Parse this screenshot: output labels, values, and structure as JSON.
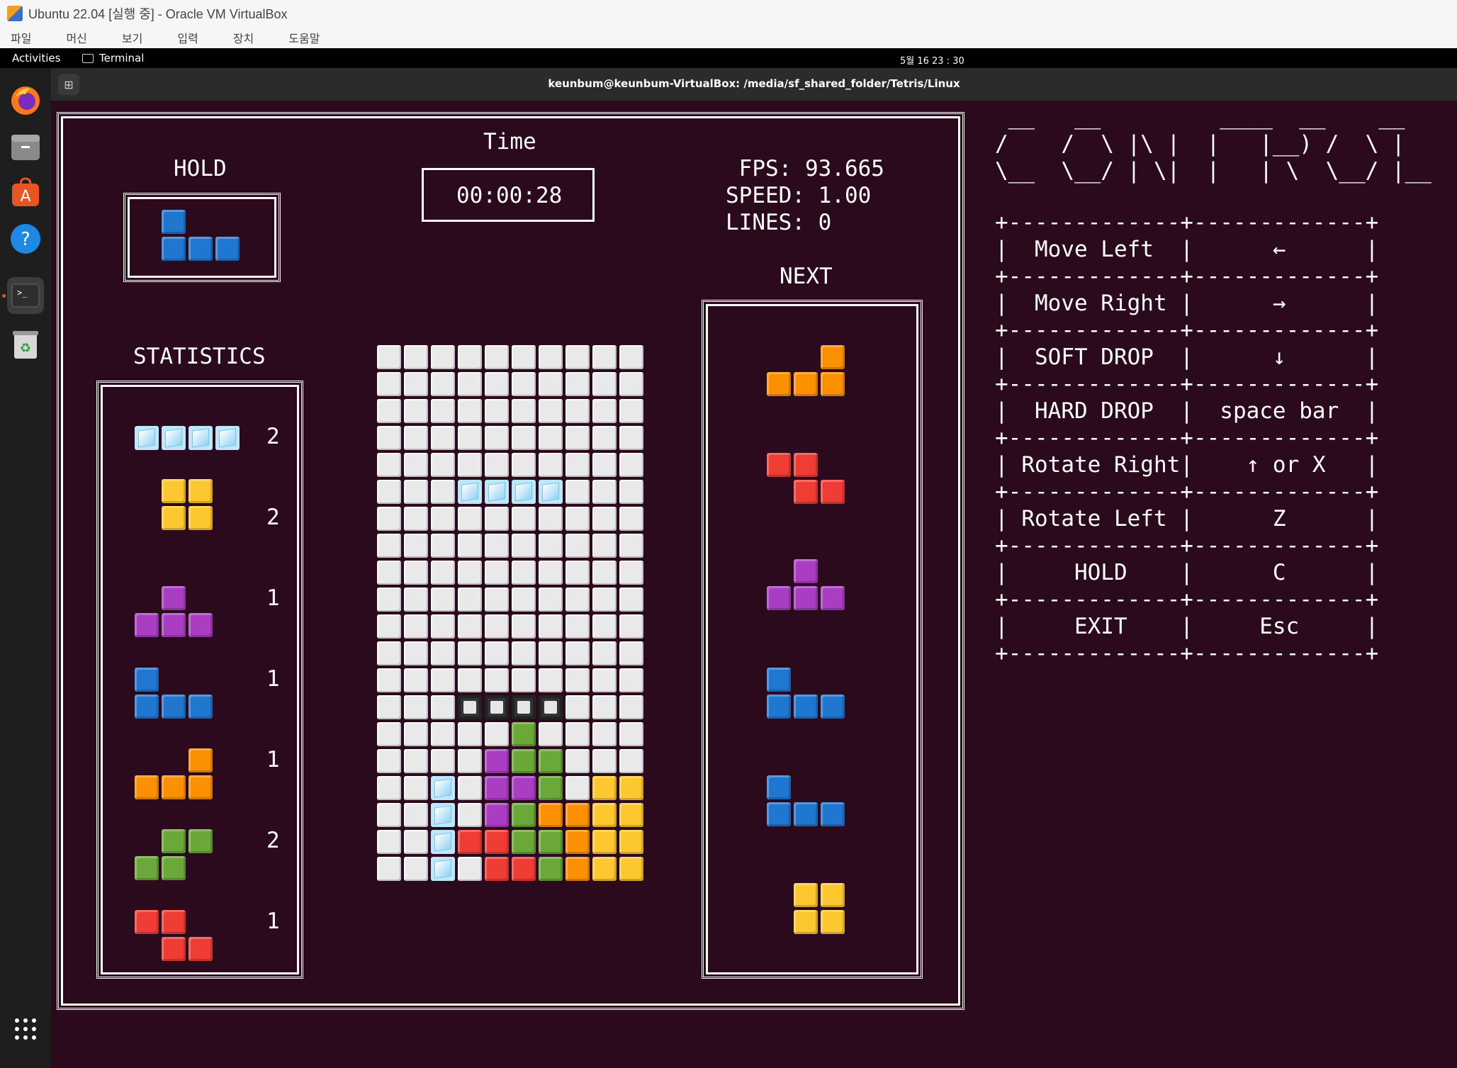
{
  "window": {
    "title": "Ubuntu 22.04 [실행 중] - Oracle VM VirtualBox"
  },
  "menu": [
    "파일",
    "머신",
    "보기",
    "입력",
    "장치",
    "도움말"
  ],
  "topbar": {
    "activities": "Activities",
    "app": "Terminal",
    "clock": "5월 16  23 : 30"
  },
  "terminal": {
    "path": "keunbum@keunbum-VirtualBox: /media/sf_shared_folder/Tetris/Linux"
  },
  "game": {
    "hold_label": "HOLD",
    "time_label": "Time",
    "time_value": "00:00:28",
    "fps_line": " FPS: 93.665",
    "speed_line": "SPEED: 1.00",
    "lines_line": "LINES: 0",
    "next_label": "NEXT",
    "stats_label": "STATISTICS",
    "stats": [
      {
        "piece": "I",
        "count": "2"
      },
      {
        "piece": "O",
        "count": "2"
      },
      {
        "piece": "T",
        "count": "1"
      },
      {
        "piece": "J",
        "count": "1"
      },
      {
        "piece": "L",
        "count": "1"
      },
      {
        "piece": "S",
        "count": "2"
      },
      {
        "piece": "Z",
        "count": "1"
      }
    ],
    "hold_piece": "J",
    "next_pieces": [
      "L",
      "Z",
      "T",
      "J",
      "J",
      "O"
    ],
    "colors": {
      "I": "#bfe7fb",
      "O": "#fdc82f",
      "T": "#a93ec2",
      "J": "#1f77d0",
      "L": "#fb9000",
      "S": "#6aa839",
      "Z": "#ef3c35"
    },
    "board": [
      "..........",
      "..........",
      "..........",
      "..........",
      "..........",
      "...IIII...",
      "..........",
      "..........",
      "..........",
      "..........",
      "..........",
      "..........",
      "..........",
      "...GGGG...",
      ".....S....",
      "....TSS...",
      "..I.TTS.OO",
      "..I.TSLLOO",
      "..IZZSSLOO",
      "..I.ZZSLOO"
    ]
  },
  "controls": {
    "ascii_title": [
      " __   __         ____  __    __     ",
      "/    /  \\ |\\ |  |   |__) /  \\ |    ",
      "\\__  \\__/ | \\|  |   | \\  \\__/ |__  "
    ],
    "separator": "+-------------+-------------+",
    "rows": [
      {
        "action": "|  Move Left  |      ←      |"
      },
      {
        "action": "|  Move Right |      →      |"
      },
      {
        "action": "|  SOFT DROP  |      ↓      |"
      },
      {
        "action": "|  HARD DROP  |  space bar  |"
      },
      {
        "action": "| Rotate Right|    ↑ or X   |"
      },
      {
        "action": "| Rotate Left |      Z      |"
      },
      {
        "action": "|     HOLD    |      C      |"
      },
      {
        "action": "|     EXIT    |     Esc     |"
      }
    ]
  }
}
